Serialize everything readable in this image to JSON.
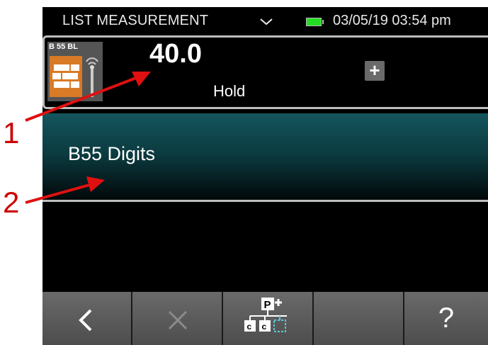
{
  "status_bar": {
    "title": "LIST MEASUREMENT",
    "chevron": "chevron-down-icon",
    "battery": "battery-icon",
    "datetime": "03/05/19 03:54 pm"
  },
  "measurement": {
    "probe_label": "B 55 BL",
    "probe_icon": "brick-wall-sensor-icon",
    "value": "40.0",
    "mode": "Hold",
    "add_icon": "plus-icon"
  },
  "list": {
    "selected_item": "B55 Digits"
  },
  "toolbar": {
    "back_icon": "chevron-left-icon",
    "cancel_icon": "close-icon",
    "hierarchy_icon": "add-hierarchy-icon",
    "help_label": "?"
  },
  "annotations": {
    "marker_1": "1",
    "marker_2": "2",
    "arrow_color": "#e01010"
  }
}
